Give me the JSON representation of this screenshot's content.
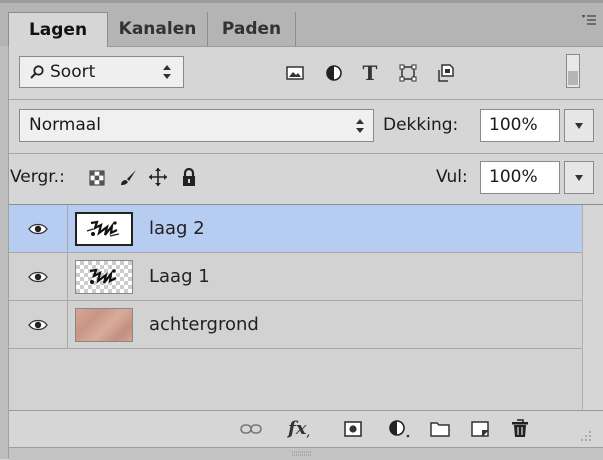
{
  "tabs": [
    {
      "label": "Lagen"
    },
    {
      "label": "Kanalen"
    },
    {
      "label": "Paden"
    }
  ],
  "filter": {
    "kind_label": "Soort",
    "search_icon": "search-icon"
  },
  "blend": {
    "mode": "Normaal",
    "opacity_label": "Dekking:",
    "opacity_value": "100%"
  },
  "lock": {
    "label": "Vergr.:",
    "fill_label": "Vul:",
    "fill_value": "100%"
  },
  "layers": [
    {
      "name": "laag 2",
      "selected": true
    },
    {
      "name": "Laag 1",
      "selected": false
    },
    {
      "name": "achtergrond",
      "selected": false
    }
  ],
  "colors": {
    "selected_row": "#b6ccf0",
    "panel_bg": "#d6d6d6",
    "tab_bar": "#b4b4b4"
  }
}
